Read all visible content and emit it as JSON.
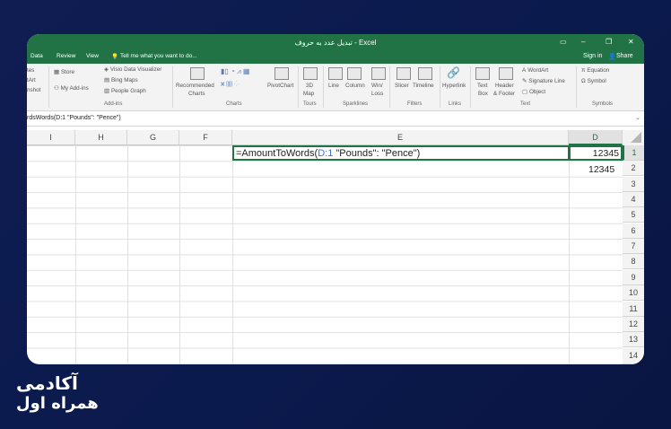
{
  "window": {
    "title": "تبدیل عدد به حروف - Excel"
  },
  "tabs": {
    "data": "Data",
    "review": "Review",
    "view": "View",
    "tell_me": "Tell me what you want to do..."
  },
  "account": {
    "sign_in": "Sign in",
    "share": "Share"
  },
  "ribbon": {
    "left_partial": {
      "tes": "tes",
      "tart": "tArt",
      "nshot": "nshot"
    },
    "addins": {
      "store": "Store",
      "my_addins": "My Add-ins",
      "visio": "Visio Data Visualizer",
      "bing": "Bing Maps",
      "people": "People Graph",
      "group": "Add-ins"
    },
    "charts": {
      "recommended_1": "Recommended",
      "recommended_2": "Charts",
      "pivotchart": "PivotChart",
      "group": "Charts"
    },
    "tours": {
      "map_1": "3D",
      "map_2": "Map",
      "group": "Tours"
    },
    "sparklines": {
      "line": "Line",
      "column": "Column",
      "winloss_1": "Win/",
      "winloss_2": "Loss",
      "group": "Sparklines"
    },
    "filters": {
      "slicer": "Slicer",
      "timeline": "Timeline",
      "group": "Filters"
    },
    "links": {
      "hyperlink": "Hyperlink",
      "group": "Links"
    },
    "text": {
      "textbox_1": "Text",
      "textbox_2": "Box",
      "header_1": "Header",
      "header_2": "& Footer",
      "wordart": "WordArt",
      "signature": "Signature Line",
      "object": "Object",
      "group": "Text"
    },
    "symbols": {
      "equation": "Equation",
      "symbol": "Symbol",
      "group": "Symbols"
    }
  },
  "formula_bar": {
    "text": "rdsWords(D:1 \"Pounds\": \"Pence\")"
  },
  "columns": [
    "I",
    "H",
    "G",
    "F",
    "E",
    "D"
  ],
  "rows": [
    "1",
    "2",
    "3",
    "4",
    "5",
    "6",
    "7",
    "8",
    "9",
    "10",
    "11",
    "12",
    "13",
    "14"
  ],
  "cells": {
    "e1_prefix": "=AmountToWords(",
    "e1_ref": "D:1",
    "e1_suffix": " \"Pounds\": \"Pence\")",
    "d1": "12345",
    "d2": "12345"
  },
  "logo": {
    "line1": "آکادمی",
    "line2": "همراه اول"
  }
}
